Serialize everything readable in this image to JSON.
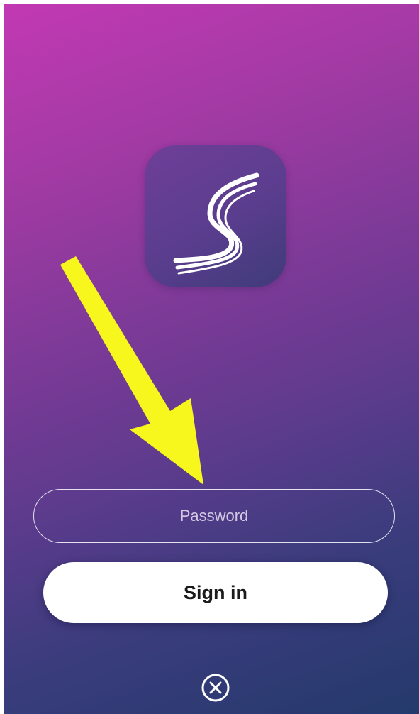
{
  "app": {
    "logo_letter": "S",
    "logo_icon": "swoosh-s-logo-icon"
  },
  "annotation": {
    "icon": "yellow-arrow-icon",
    "color": "#f7f71e"
  },
  "login": {
    "password_placeholder": "Password",
    "password_value": "",
    "signin_label": "Sign in",
    "close_icon": "close-circle-icon"
  },
  "colors": {
    "gradient_top": "#c239b3",
    "gradient_bottom": "#243a6c",
    "button_bg": "#ffffff",
    "button_text": "#1b1b1b"
  }
}
